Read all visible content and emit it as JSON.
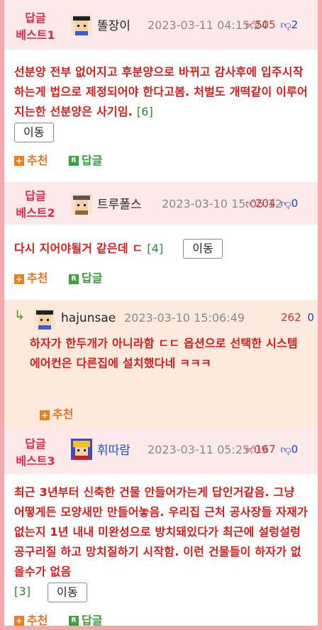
{
  "comments": [
    {
      "badge_line1": "답글",
      "badge_line2": "베스트1",
      "nick": "똘장이",
      "time": "2023-03-11 04:15:24",
      "up": "505",
      "down": "2",
      "text": "선분양 전부 없어지고 후분양으로 바뀌고 감사후에 입주시작 하는게 법으로 제정되어야 한다고봄. 처벌도 개떡같이 이루어지는한 선분양은 사기임.",
      "reply_count": "[6]",
      "move_label": "이동",
      "recommend_label": "추천",
      "reply_label": "답글"
    },
    {
      "badge_line1": "답글",
      "badge_line2": "베스트2",
      "nick": "트루폴스",
      "time": "2023-03-10 15:05:12",
      "up": "204",
      "down": "0",
      "text": "다시 지어야될거 같은데 ㄷ",
      "reply_count": "[4]",
      "move_label": "이동",
      "recommend_label": "추천",
      "reply_label": "답글"
    },
    {
      "badge_line1": "답글",
      "badge_line2": "베스트3",
      "nick": "휘따람",
      "time": "2023-03-11 05:25:09",
      "up": "167",
      "down": "0",
      "text": "최근 3년부터 신축한 건물 안들어가는게 답인거같음. 그냥 어떻게든 모양새만 만들어놓음. 우리집 근처 공사장들 자재가 없는지 1년 내내 미완성으로 방치돼있다가 최근에 설렁설렁 공구리질 하고 망치질하기 시작함. 이런 건물들이 하자가 없을수가 없음",
      "reply_count": "[3]",
      "move_label": "이동",
      "recommend_label": "추천",
      "reply_label": "답글"
    }
  ],
  "reply": {
    "arrow": "↳",
    "nick": "hajunsae",
    "time": "2023-03-10 15:06:49",
    "up": "262",
    "down": "0",
    "text": "하자가 한두개가 아니라함 ㄷㄷ 옵션으로 선택한 시스템 에어컨은 다른집에 설치했다네 ㅋㅋㅋ",
    "recommend_label": "추천"
  },
  "colors": {
    "border": "#f5a9ad",
    "badge": "#e0284a",
    "comment_text": "#d61b1b",
    "reply_bg": "#fdeadc",
    "down_vote": "#1a3fc1"
  },
  "icons": [
    "avatar-icon",
    "thumbs-up-icon",
    "thumbs-down-icon",
    "plus-icon",
    "reply-r-icon",
    "reply-arrow-icon"
  ]
}
